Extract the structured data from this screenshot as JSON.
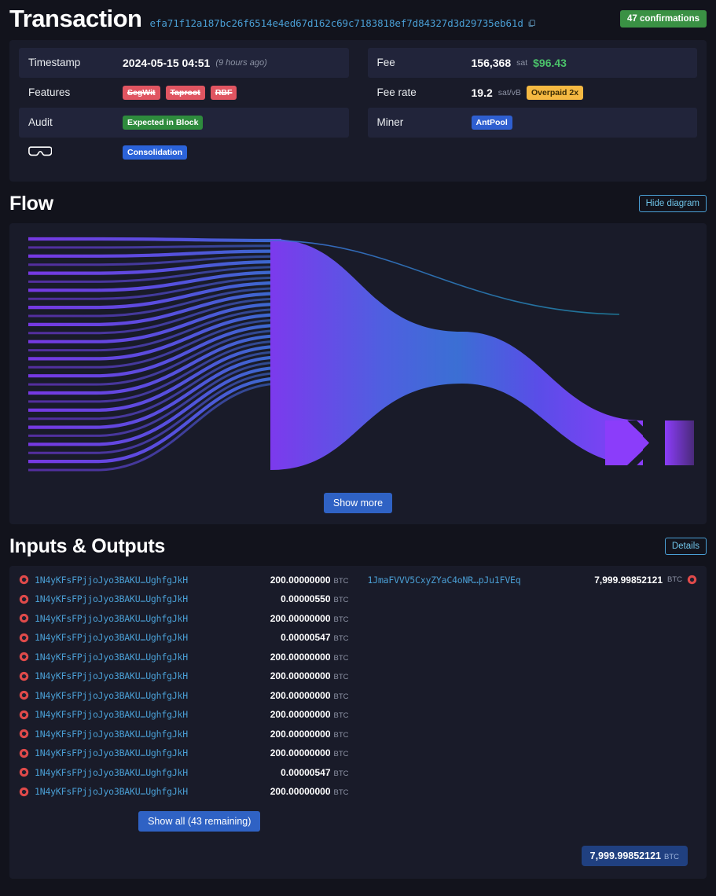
{
  "header": {
    "title": "Transaction",
    "hash": "efa71f12a187bc26f6514e4ed67d162c69c7183818ef7d84327d3d29735eb61d",
    "copy_icon": "copy-icon",
    "confirmations": "47 confirmations"
  },
  "details": {
    "left": [
      {
        "label": "Timestamp",
        "value": "2024-05-15 04:51",
        "note": "(9 hours ago)",
        "kind": "timestamp"
      },
      {
        "label": "Features",
        "kind": "badges",
        "badges": [
          {
            "text": "SegWit",
            "style": "red"
          },
          {
            "text": "Taproot",
            "style": "red"
          },
          {
            "text": "RBF",
            "style": "red"
          }
        ]
      },
      {
        "label": "Audit",
        "kind": "badges",
        "badges": [
          {
            "text": "Expected in Block",
            "style": "green"
          }
        ]
      },
      {
        "label": "",
        "icon": "goggles-icon",
        "kind": "badges",
        "badges": [
          {
            "text": "Consolidation",
            "style": "blue"
          }
        ]
      }
    ],
    "right": [
      {
        "label": "Fee",
        "kind": "fee",
        "value": "156,368",
        "unit": "sat",
        "fiat": "$96.43"
      },
      {
        "label": "Fee rate",
        "kind": "feerate",
        "value": "19.2",
        "unit": "sat/vB",
        "badge": {
          "text": "Overpaid 2x",
          "style": "amber"
        }
      },
      {
        "label": "Miner",
        "kind": "badges",
        "badges": [
          {
            "text": "AntPool",
            "style": "miner"
          }
        ]
      }
    ]
  },
  "flow": {
    "title": "Flow",
    "hide_button": "Hide diagram",
    "show_more_button": "Show more"
  },
  "io": {
    "title": "Inputs & Outputs",
    "details_button": "Details",
    "show_all_button": "Show all (43 remaining)",
    "input_icon": "input-arrow-icon",
    "output_icon": "output-arrow-icon",
    "unit": "BTC",
    "inputs": [
      {
        "address": "1N4yKFsFPjjoJyo3BAKU…UghfgJkH",
        "amount": "200.00000000"
      },
      {
        "address": "1N4yKFsFPjjoJyo3BAKU…UghfgJkH",
        "amount": "0.00000550"
      },
      {
        "address": "1N4yKFsFPjjoJyo3BAKU…UghfgJkH",
        "amount": "200.00000000"
      },
      {
        "address": "1N4yKFsFPjjoJyo3BAKU…UghfgJkH",
        "amount": "0.00000547"
      },
      {
        "address": "1N4yKFsFPjjoJyo3BAKU…UghfgJkH",
        "amount": "200.00000000"
      },
      {
        "address": "1N4yKFsFPjjoJyo3BAKU…UghfgJkH",
        "amount": "200.00000000"
      },
      {
        "address": "1N4yKFsFPjjoJyo3BAKU…UghfgJkH",
        "amount": "200.00000000"
      },
      {
        "address": "1N4yKFsFPjjoJyo3BAKU…UghfgJkH",
        "amount": "200.00000000"
      },
      {
        "address": "1N4yKFsFPjjoJyo3BAKU…UghfgJkH",
        "amount": "200.00000000"
      },
      {
        "address": "1N4yKFsFPjjoJyo3BAKU…UghfgJkH",
        "amount": "200.00000000"
      },
      {
        "address": "1N4yKFsFPjjoJyo3BAKU…UghfgJkH",
        "amount": "0.00000547"
      },
      {
        "address": "1N4yKFsFPjjoJyo3BAKU…UghfgJkH",
        "amount": "200.00000000"
      }
    ],
    "outputs": [
      {
        "address": "1JmaFVVV5CxyZYaC4oNR…pJu1FVEq",
        "amount": "7,999.99852121"
      }
    ],
    "total": {
      "amount": "7,999.99852121",
      "unit": "BTC"
    }
  },
  "colors": {
    "page_bg": "#12131c",
    "panel_bg": "#191b29",
    "row_bg": "#21243a",
    "link": "#4a9fd5",
    "green": "#3a9144",
    "red": "#e05561",
    "blue": "#2b63d9",
    "amber": "#f5b942",
    "flow_input": "#7c3aed",
    "flow_mid": "#3b6fd4",
    "flow_output": "#8b3dfa",
    "fee_line": "#2596be"
  }
}
